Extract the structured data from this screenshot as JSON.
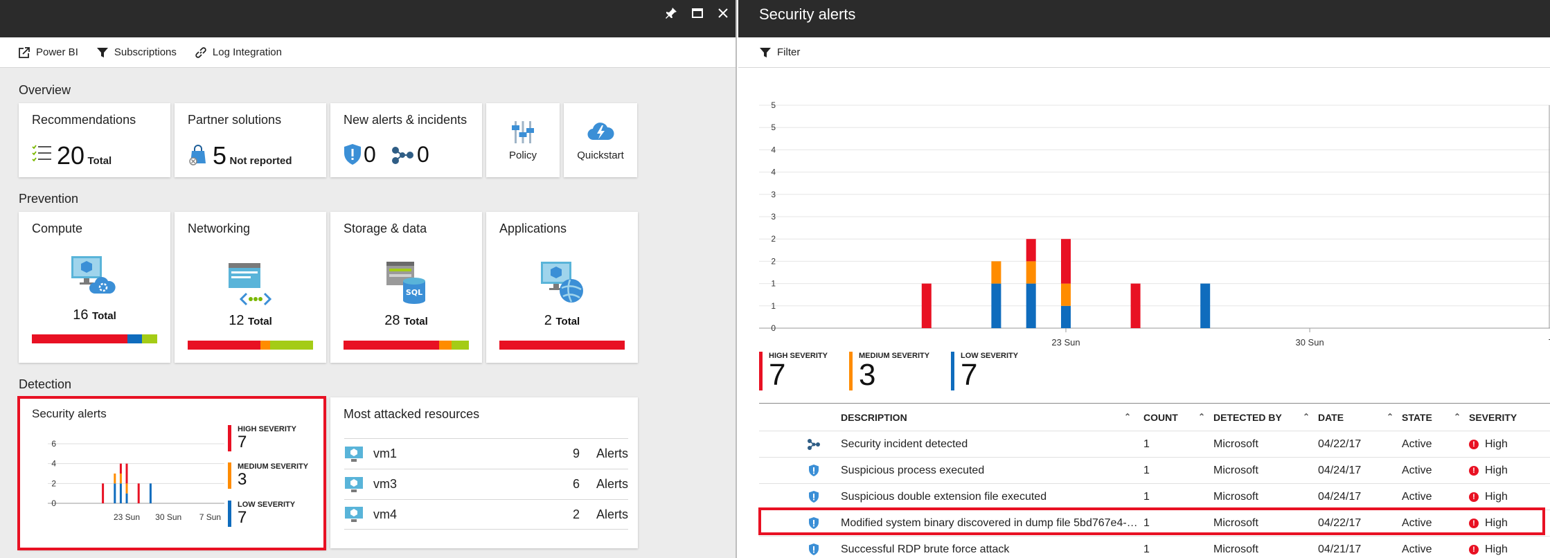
{
  "left": {
    "toolbar": [
      {
        "label": "Power BI",
        "icon": "external-link-icon"
      },
      {
        "label": "Subscriptions",
        "icon": "filter-icon"
      },
      {
        "label": "Log Integration",
        "icon": "link-icon"
      }
    ],
    "overview": {
      "label": "Overview",
      "recommendations": {
        "title": "Recommendations",
        "count": "20",
        "suffix": "Total"
      },
      "partner": {
        "title": "Partner solutions",
        "count": "5",
        "suffix": "Not reported"
      },
      "alerts": {
        "title": "New alerts & incidents",
        "alerts_count": "0",
        "incidents_count": "0"
      },
      "policy": {
        "label": "Policy"
      },
      "quickstart": {
        "label": "Quickstart"
      }
    },
    "prevention": {
      "label": "Prevention",
      "tiles": [
        {
          "title": "Compute",
          "count": "16",
          "suffix": "Total",
          "bar": [
            0.76,
            0.12,
            0.12
          ]
        },
        {
          "title": "Networking",
          "count": "12",
          "suffix": "Total",
          "bar": [
            0.58,
            0.08,
            0.34
          ]
        },
        {
          "title": "Storage & data",
          "count": "28",
          "suffix": "Total",
          "bar": [
            0.76,
            0.1,
            0.14
          ]
        },
        {
          "title": "Applications",
          "count": "2",
          "suffix": "Total",
          "bar": [
            1.0,
            0,
            0
          ]
        }
      ]
    },
    "detection": {
      "label": "Detection",
      "security_alerts": {
        "title": "Security alerts",
        "yticks": [
          "6",
          "4",
          "2",
          "0"
        ],
        "xticks": [
          "23 Sun",
          "30 Sun",
          "7 Sun"
        ],
        "high_label": "HIGH SEVERITY",
        "high": "7",
        "medium_label": "MEDIUM SEVERITY",
        "medium": "3",
        "low_label": "LOW SEVERITY",
        "low": "7"
      },
      "most_attacked": {
        "title": "Most attacked resources",
        "rows": [
          {
            "name": "vm1",
            "count": "9",
            "unit": "Alerts"
          },
          {
            "name": "vm3",
            "count": "6",
            "unit": "Alerts"
          },
          {
            "name": "vm4",
            "count": "2",
            "unit": "Alerts"
          }
        ]
      }
    }
  },
  "right": {
    "title": "Security alerts",
    "filter_label": "Filter",
    "severity": {
      "high_label": "HIGH SEVERITY",
      "high": "7",
      "medium_label": "MEDIUM SEVERITY",
      "medium": "3",
      "low_label": "LOW SEVERITY",
      "low": "7"
    },
    "table": {
      "headers": [
        "DESCRIPTION",
        "COUNT",
        "DETECTED BY",
        "DATE",
        "STATE",
        "SEVERITY"
      ],
      "rows": [
        {
          "icon": "incident-icon",
          "description": "Security incident detected",
          "count": "1",
          "detected_by": "Microsoft",
          "date": "04/22/17",
          "state": "Active",
          "severity": "High"
        },
        {
          "icon": "shield-icon",
          "description": "Suspicious process executed",
          "count": "1",
          "detected_by": "Microsoft",
          "date": "04/24/17",
          "state": "Active",
          "severity": "High"
        },
        {
          "icon": "shield-icon",
          "description": "Suspicious double extension file executed",
          "count": "1",
          "detected_by": "Microsoft",
          "date": "04/24/17",
          "state": "Active",
          "severity": "High"
        },
        {
          "icon": "shield-icon",
          "description": "Modified system binary discovered in dump file 5bd767e4-2...",
          "count": "1",
          "detected_by": "Microsoft",
          "date": "04/22/17",
          "state": "Active",
          "severity": "High"
        },
        {
          "icon": "shield-icon",
          "description": "Successful RDP brute force attack",
          "count": "1",
          "detected_by": "Microsoft",
          "date": "04/21/17",
          "state": "Active",
          "severity": "High"
        }
      ]
    }
  },
  "colors": {
    "high": "#e81123",
    "medium": "#ff8c00",
    "low": "#0f6cbd",
    "green": "#a4cc16"
  },
  "chart_data": [
    {
      "type": "bar",
      "stacked": true,
      "title": "",
      "yticks": [
        "5",
        "5",
        "4",
        "4",
        "3",
        "3",
        "2",
        "2",
        "1",
        "1",
        "0"
      ],
      "xticks": [
        "23 Sun",
        "30 Sun",
        "7"
      ],
      "ylim": [
        0,
        5
      ],
      "series": [
        {
          "name": "LOW SEVERITY",
          "values": [
            0,
            2,
            2,
            1,
            0,
            2
          ]
        },
        {
          "name": "MEDIUM SEVERITY",
          "values": [
            0,
            1,
            1,
            1,
            0,
            0
          ]
        },
        {
          "name": "HIGH SEVERITY",
          "values": [
            2,
            0,
            1,
            2,
            2,
            0
          ]
        }
      ],
      "bar_days": [
        -4,
        -2,
        -1,
        0,
        2,
        4
      ]
    }
  ]
}
